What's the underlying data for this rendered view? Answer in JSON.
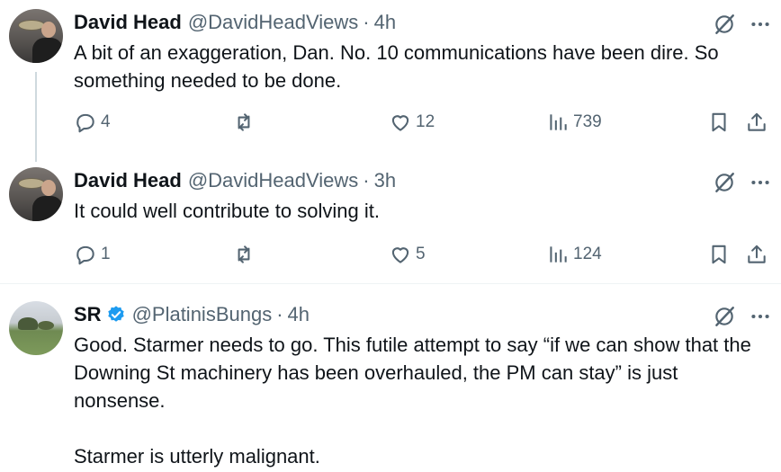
{
  "tweets": [
    {
      "name": "David Head",
      "handle": "@DavidHeadViews",
      "time": "4h",
      "text": "A bit of an exaggeration, Dan. No. 10 communications have been dire. So something needed to be done.",
      "replies": "4",
      "reposts": "",
      "likes": "12",
      "views": "739"
    },
    {
      "name": "David Head",
      "handle": "@DavidHeadViews",
      "time": "3h",
      "text": "It could well contribute to solving it.",
      "replies": "1",
      "reposts": "",
      "likes": "5",
      "views": "124"
    },
    {
      "name": "SR",
      "handle": "@PlatinisBungs",
      "time": "4h",
      "text": "Good. Starmer needs to go. This futile attempt to say “if we can show that the Downing St machinery has been overhauled, the PM can stay” is just nonsense.\n\nStarmer is utterly malignant.",
      "verified": true
    }
  ],
  "separator": "·",
  "colors": {
    "text": "#0f1419",
    "secondary": "#536471",
    "verified": "#1d9bf0",
    "thread_line": "#cfd9de"
  },
  "icons": [
    "reply-icon",
    "repost-icon",
    "like-icon",
    "views-icon",
    "bookmark-icon",
    "share-icon",
    "grok-icon",
    "more-icon",
    "verified-badge-icon"
  ]
}
